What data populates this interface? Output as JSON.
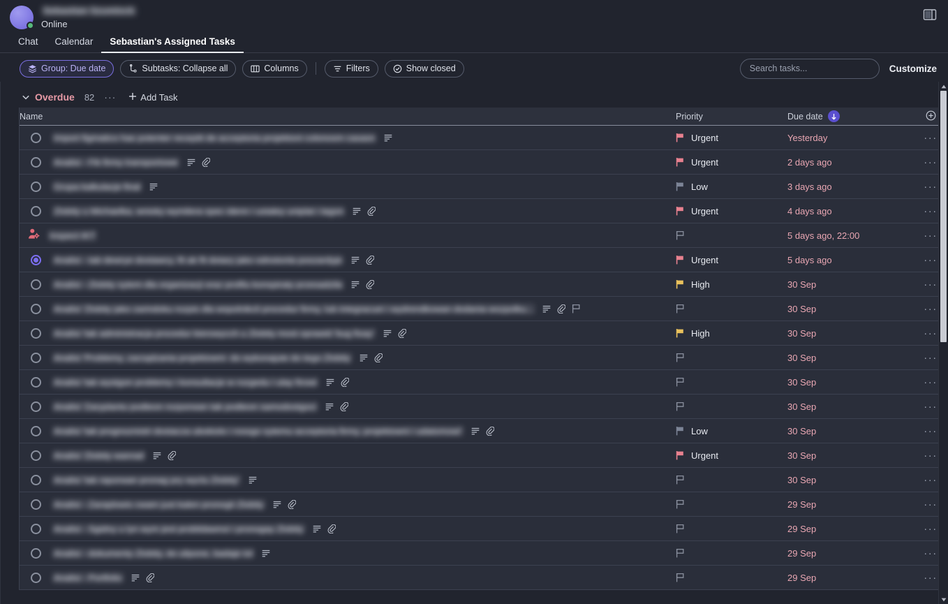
{
  "header": {
    "user_name": "Sebastian Szumlock",
    "status": "Online",
    "avatar_icon": "user-avatar",
    "presence_icon": "online-dot",
    "panel_toggle_icon": "toggle-side-panel-icon"
  },
  "tabs": [
    {
      "label": "Chat",
      "active": false
    },
    {
      "label": "Calendar",
      "active": false
    },
    {
      "label": "Sebastian's Assigned Tasks",
      "active": true
    }
  ],
  "toolbar": {
    "chips": [
      {
        "label": "Group: Due date",
        "icon": "layers-icon",
        "accent": true
      },
      {
        "label": "Subtasks: Collapse all",
        "icon": "subtask-icon",
        "accent": false
      },
      {
        "label": "Columns",
        "icon": "columns-icon",
        "accent": false
      },
      {
        "label": "Filters",
        "icon": "filter-icon",
        "accent": false,
        "after_sep": true
      },
      {
        "label": "Show closed",
        "icon": "check-circle-icon",
        "accent": false
      }
    ],
    "search_placeholder": "Search tasks...",
    "search_value": "",
    "customize_label": "Customize"
  },
  "group": {
    "caret_icon": "chevron-down-icon",
    "title": "Overdue",
    "count": "82",
    "dots": "···",
    "add_task_label": "Add Task",
    "add_task_icon": "plus-icon"
  },
  "columns": {
    "name": "Name",
    "priority": "Priority",
    "due_date": "Due date",
    "sort_icon": "sort-descending-arrow-icon",
    "add_column_icon": "plus-circle-icon"
  },
  "colors": {
    "accent_purple": "#7b6ef0",
    "overdue_pink": "#e79aa6",
    "urgent_flag": "#e8818f",
    "high_flag": "#e9c15c",
    "low_flag": "#7c8496",
    "empty_flag": "#8a909e",
    "row_bg": "#2a2e3a",
    "page_bg": "#21242e",
    "online_green": "#57b97a"
  },
  "rows": [
    {
      "name": "Import figmatico has potenter receptit de acceptoria projektoni colonosm casasn",
      "marker": "circle",
      "icons": [
        "description-icon"
      ],
      "priority": "Urgent",
      "priority_flag": "urgent",
      "due": "Yesterday",
      "menu": "···"
    },
    {
      "name": "Analisi - Fik firmy transportowe",
      "marker": "circle",
      "icons": [
        "description-icon",
        "attachment-icon"
      ],
      "priority": "Urgent",
      "priority_flag": "urgent",
      "due": "2 days ago",
      "menu": "···"
    },
    {
      "name": "Grupa kalkulacje final",
      "marker": "circle",
      "icons": [
        "description-icon"
      ],
      "priority": "Low",
      "priority_flag": "low",
      "due": "3 days ago",
      "menu": "···"
    },
    {
      "name": "Zlobity u Michaelka, wnioky wymilera spec idenn i ustaley uniplat i tagon",
      "marker": "circle",
      "icons": [
        "description-icon",
        "attachment-icon"
      ],
      "priority": "Urgent",
      "priority_flag": "urgent",
      "due": "4 days ago",
      "menu": "···"
    },
    {
      "name": "Inspect IKT",
      "marker": "person-gear",
      "icons": [],
      "priority": "",
      "priority_flag": "none",
      "due": "5 days ago, 22:00",
      "menu": "···"
    },
    {
      "name": "Analisi - tab dewrye dostawcy, fit ak fit dotary jako odnotonla poszardyje",
      "marker": "circle-filled",
      "icons": [
        "description-icon",
        "attachment-icon"
      ],
      "priority": "Urgent",
      "priority_flag": "urgent",
      "due": "5 days ago",
      "menu": "···"
    },
    {
      "name": "Analisi - Zlobity sytem dla organizacji oraz profilu konspiraty przesadzila",
      "marker": "circle",
      "icons": [
        "description-icon",
        "attachment-icon"
      ],
      "priority": "High",
      "priority_flag": "high",
      "due": "30 Sep",
      "menu": "···"
    },
    {
      "name": "Analisi 'Zlobity jako zarindoku rozpis dla wspolnikcli procedur firmy, lub integracuei i wydrendkowan dodania wszpolku...",
      "marker": "circle",
      "icons": [
        "description-icon",
        "attachment-icon",
        "flag-icon"
      ],
      "priority": "",
      "priority_flag": "none",
      "due": "30 Sep",
      "menu": "···"
    },
    {
      "name": "Analisi 'tak administracja procedur kierowycch u Zlobity most oprawid 'bug fixay'",
      "marker": "circle",
      "icons": [
        "description-icon",
        "attachment-icon"
      ],
      "priority": "High",
      "priority_flag": "high",
      "due": "30 Sep",
      "menu": "···"
    },
    {
      "name": "Analisi 'Problemy, zarządzania projektowni- do wykonajute do tego Zlobity",
      "marker": "circle",
      "icons": [
        "description-icon",
        "attachment-icon"
      ],
      "priority": "",
      "priority_flag": "none",
      "due": "30 Sep",
      "menu": "···"
    },
    {
      "name": "Analisi 'tak wystgon problemy i konsultacje w rozgedu i ulay firowi",
      "marker": "circle",
      "icons": [
        "description-icon",
        "attachment-icon"
      ],
      "priority": "",
      "priority_flag": "none",
      "due": "30 Sep",
      "menu": "···"
    },
    {
      "name": "Analisi 'Zaryplantu podteon rozporwan tak podteon samodostgoci",
      "marker": "circle",
      "icons": [
        "description-icon",
        "attachment-icon"
      ],
      "priority": "",
      "priority_flag": "none",
      "due": "30 Sep",
      "menu": "···"
    },
    {
      "name": "Analisi 'tak prognoznistri dostacza ubokiolo i rossgo sytemu acceptoria firmy, projektowni i udatomowi'",
      "marker": "circle",
      "icons": [
        "description-icon",
        "attachment-icon"
      ],
      "priority": "Low",
      "priority_flag": "low",
      "due": "30 Sep",
      "menu": "···"
    },
    {
      "name": "Analisi 'Zlobity wanrad",
      "marker": "circle",
      "icons": [
        "description-icon",
        "attachment-icon"
      ],
      "priority": "Urgent",
      "priority_flag": "urgent",
      "due": "30 Sep",
      "menu": "···"
    },
    {
      "name": "Analisi 'tak raporwan pronag pry wyclu Zlobity'",
      "marker": "circle",
      "icons": [
        "description-icon"
      ],
      "priority": "",
      "priority_flag": "none",
      "due": "30 Sep",
      "menu": "···"
    },
    {
      "name": "Analisi - Zaraplowis cwam just kalen pronogii Zlobity",
      "marker": "circle",
      "icons": [
        "description-icon",
        "attachment-icon"
      ],
      "priority": "",
      "priority_flag": "none",
      "due": "29 Sep",
      "menu": "···"
    },
    {
      "name": "Analisi - Sgidny u lyn wym jest problidawnoi i pronogay Zlobity",
      "marker": "circle",
      "icons": [
        "description-icon",
        "attachment-icon"
      ],
      "priority": "",
      "priority_flag": "none",
      "due": "29 Sep",
      "menu": "···"
    },
    {
      "name": "Analisi - dokumenty Zlobity, do ulipone, badaje tol",
      "marker": "circle",
      "icons": [
        "description-icon"
      ],
      "priority": "",
      "priority_flag": "none",
      "due": "29 Sep",
      "menu": "···"
    },
    {
      "name": "Analisi - Portfolio",
      "marker": "circle",
      "icons": [
        "description-icon",
        "attachment-icon"
      ],
      "priority": "",
      "priority_flag": "none",
      "due": "29 Sep",
      "menu": "···"
    }
  ],
  "scrollbar": {
    "up_icon": "scroll-up-arrow-icon",
    "down_icon": "scroll-down-arrow-icon",
    "thumb_name": "scrollbar-thumb"
  }
}
